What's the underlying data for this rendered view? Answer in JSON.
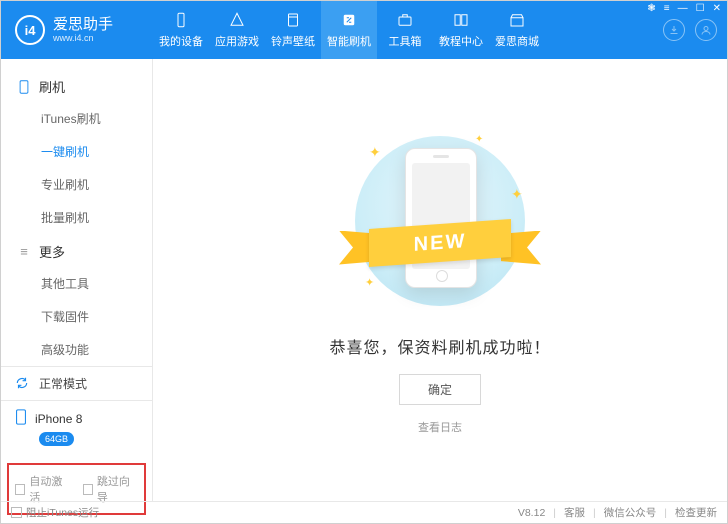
{
  "app": {
    "name": "爱思助手",
    "url": "www.i4.cn",
    "logo_text": "i4"
  },
  "win": {
    "i1": "❃",
    "i2": "≡",
    "i3": "—",
    "i4": "☐",
    "i5": "✕"
  },
  "tabs": [
    {
      "id": "device",
      "label": "我的设备"
    },
    {
      "id": "apps",
      "label": "应用游戏"
    },
    {
      "id": "ring",
      "label": "铃声壁纸"
    },
    {
      "id": "flash",
      "label": "智能刷机",
      "active": true
    },
    {
      "id": "tools",
      "label": "工具箱"
    },
    {
      "id": "tutorial",
      "label": "教程中心"
    },
    {
      "id": "mall",
      "label": "爱思商城"
    }
  ],
  "header_icons": {
    "download": "↓",
    "user": "◉"
  },
  "sidebar": {
    "groups": [
      {
        "title": "刷机",
        "icon": "phone",
        "items": [
          "iTunes刷机",
          "一键刷机",
          "专业刷机",
          "批量刷机"
        ],
        "active_index": 1
      },
      {
        "title": "更多",
        "icon": "more",
        "items": [
          "其他工具",
          "下载固件",
          "高级功能"
        ]
      }
    ],
    "status": {
      "label": "正常模式"
    },
    "device": {
      "name": "iPhone 8",
      "capacity": "64GB"
    },
    "options": [
      {
        "id": "auto_activate",
        "label": "自动激活"
      },
      {
        "id": "skip_guide",
        "label": "跳过向导"
      }
    ]
  },
  "main": {
    "ribbon": "NEW",
    "message": "恭喜您，保资料刷机成功啦！",
    "confirm": "确定",
    "view_log": "查看日志"
  },
  "footer": {
    "block_itunes": "阻止iTunes运行",
    "version": "V8.12",
    "links": [
      "客服",
      "微信公众号",
      "检查更新"
    ]
  }
}
